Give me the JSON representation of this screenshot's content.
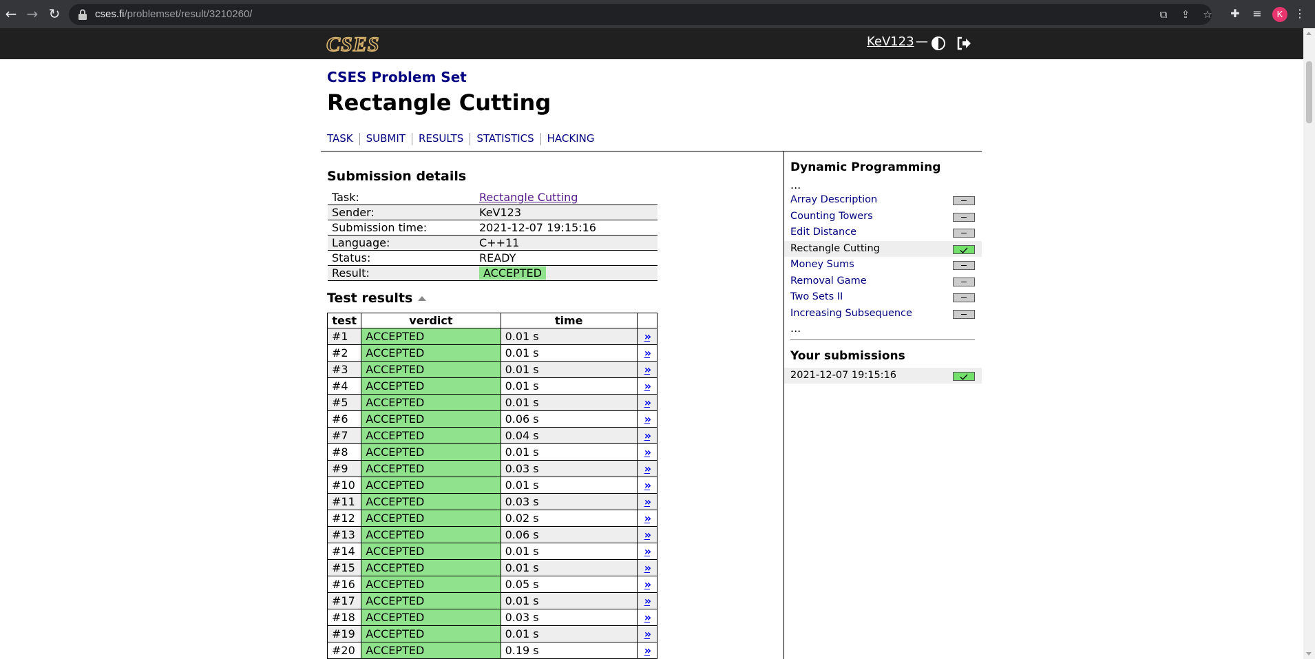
{
  "browser": {
    "url_host": "cses.fi",
    "url_path": "/problemset/result/3210260/",
    "profile_initial": "K"
  },
  "header": {
    "logo": "CSES",
    "username": "KeV123",
    "separator": "—"
  },
  "page": {
    "section": "CSES Problem Set",
    "title": "Rectangle Cutting"
  },
  "nav": [
    "TASK",
    "SUBMIT",
    "RESULTS",
    "STATISTICS",
    "HACKING"
  ],
  "submission": {
    "heading": "Submission details",
    "rows": [
      {
        "label": "Task:",
        "value": "Rectangle Cutting"
      },
      {
        "label": "Sender:",
        "value": "KeV123"
      },
      {
        "label": "Submission time:",
        "value": "2021-12-07 19:15:16"
      },
      {
        "label": "Language:",
        "value": "C++11"
      },
      {
        "label": "Status:",
        "value": "READY"
      },
      {
        "label": "Result:",
        "value": "ACCEPTED"
      }
    ]
  },
  "tests": {
    "heading": "Test results",
    "columns": [
      "test",
      "verdict",
      "time"
    ],
    "link_glyph": "»",
    "rows": [
      {
        "test": "#1",
        "verdict": "ACCEPTED",
        "time": "0.01 s"
      },
      {
        "test": "#2",
        "verdict": "ACCEPTED",
        "time": "0.01 s"
      },
      {
        "test": "#3",
        "verdict": "ACCEPTED",
        "time": "0.01 s"
      },
      {
        "test": "#4",
        "verdict": "ACCEPTED",
        "time": "0.01 s"
      },
      {
        "test": "#5",
        "verdict": "ACCEPTED",
        "time": "0.01 s"
      },
      {
        "test": "#6",
        "verdict": "ACCEPTED",
        "time": "0.06 s"
      },
      {
        "test": "#7",
        "verdict": "ACCEPTED",
        "time": "0.04 s"
      },
      {
        "test": "#8",
        "verdict": "ACCEPTED",
        "time": "0.01 s"
      },
      {
        "test": "#9",
        "verdict": "ACCEPTED",
        "time": "0.03 s"
      },
      {
        "test": "#10",
        "verdict": "ACCEPTED",
        "time": "0.01 s"
      },
      {
        "test": "#11",
        "verdict": "ACCEPTED",
        "time": "0.03 s"
      },
      {
        "test": "#12",
        "verdict": "ACCEPTED",
        "time": "0.02 s"
      },
      {
        "test": "#13",
        "verdict": "ACCEPTED",
        "time": "0.06 s"
      },
      {
        "test": "#14",
        "verdict": "ACCEPTED",
        "time": "0.01 s"
      },
      {
        "test": "#15",
        "verdict": "ACCEPTED",
        "time": "0.01 s"
      },
      {
        "test": "#16",
        "verdict": "ACCEPTED",
        "time": "0.05 s"
      },
      {
        "test": "#17",
        "verdict": "ACCEPTED",
        "time": "0.01 s"
      },
      {
        "test": "#18",
        "verdict": "ACCEPTED",
        "time": "0.03 s"
      },
      {
        "test": "#19",
        "verdict": "ACCEPTED",
        "time": "0.01 s"
      },
      {
        "test": "#20",
        "verdict": "ACCEPTED",
        "time": "0.19 s"
      }
    ]
  },
  "sidebar": {
    "heading": "Dynamic Programming",
    "ellipsis": "...",
    "tasks": [
      {
        "name": "Array Description",
        "status": "none"
      },
      {
        "name": "Counting Towers",
        "status": "none"
      },
      {
        "name": "Edit Distance",
        "status": "none"
      },
      {
        "name": "Rectangle Cutting",
        "status": "solved"
      },
      {
        "name": "Money Sums",
        "status": "none"
      },
      {
        "name": "Removal Game",
        "status": "none"
      },
      {
        "name": "Two Sets II",
        "status": "none"
      },
      {
        "name": "Increasing Subsequence",
        "status": "none"
      }
    ],
    "submissions_heading": "Your submissions",
    "submissions": [
      {
        "time": "2021-12-07 19:15:16",
        "status": "solved"
      }
    ]
  },
  "colors": {
    "accepted": "#90e38c",
    "header_bg": "#202020",
    "nav_link": "#000080"
  }
}
